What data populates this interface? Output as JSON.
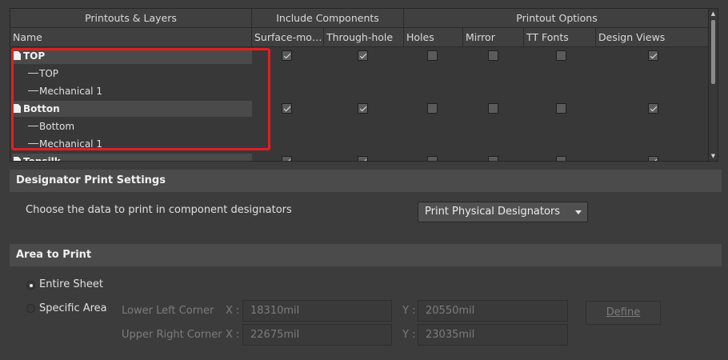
{
  "grid": {
    "group_headers": [
      "Printouts & Layers",
      "Include Components",
      "Printout Options"
    ],
    "columns": [
      "Name",
      "Surface-mo…",
      "Through-hole",
      "Holes",
      "Mirror",
      "TT Fonts",
      "Design Views"
    ],
    "rows": [
      {
        "kind": "group",
        "name": "TOP",
        "checks": [
          true,
          true,
          false,
          false,
          false,
          true
        ]
      },
      {
        "kind": "child",
        "name": "TOP"
      },
      {
        "kind": "child",
        "name": "Mechanical 1"
      },
      {
        "kind": "group",
        "name": "Botton",
        "checks": [
          true,
          true,
          false,
          false,
          false,
          true
        ]
      },
      {
        "kind": "child",
        "name": "Bottom"
      },
      {
        "kind": "child",
        "name": "Mechanical 1"
      },
      {
        "kind": "group",
        "name": "Topsilk",
        "checks": [
          true,
          true,
          false,
          false,
          false,
          true
        ]
      }
    ],
    "highlight_color": "#e02020"
  },
  "designator": {
    "title": "Designator Print Settings",
    "description": "Choose the data to print in component designators",
    "dropdown_value": "Print Physical Designators"
  },
  "area": {
    "title": "Area to Print",
    "option_entire": "Entire Sheet",
    "option_specific": "Specific Area",
    "selected": "Entire Sheet",
    "lower_left_label": "Lower Left Corner",
    "upper_right_label": "Upper Right Corner",
    "x_label": "X :",
    "y_label": "Y :",
    "lower_left_x": "18310mil",
    "lower_left_y": "20550mil",
    "upper_right_x": "22675mil",
    "upper_right_y": "23035mil",
    "define_label": "Define"
  }
}
